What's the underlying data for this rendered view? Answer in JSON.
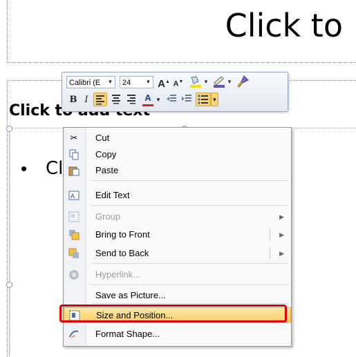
{
  "slide": {
    "title_text": "Click to",
    "subheading": "Click to add text",
    "bullet_text": "Cl"
  },
  "mini_toolbar": {
    "font_name": "Calibri (E",
    "font_size": "24",
    "buttons": {
      "grow_font": "A",
      "shrink_font": "A",
      "bold": "B",
      "italic": "I",
      "font_color": "A"
    }
  },
  "context_menu": {
    "items": [
      {
        "label": "Cut",
        "icon": "scissors-icon",
        "enabled": true
      },
      {
        "label": "Copy",
        "icon": "copy-icon",
        "enabled": true
      },
      {
        "label": "Paste",
        "icon": "paste-icon",
        "enabled": true
      },
      {
        "label": "Edit Text",
        "icon": "edit-text-icon",
        "enabled": true
      },
      {
        "label": "Group",
        "icon": "group-icon",
        "enabled": false,
        "submenu": true
      },
      {
        "label": "Bring to Front",
        "icon": "bring-to-front-icon",
        "enabled": true,
        "submenu": true
      },
      {
        "label": "Send to Back",
        "icon": "send-to-back-icon",
        "enabled": true,
        "submenu": true
      },
      {
        "label": "Hyperlink...",
        "icon": "hyperlink-icon",
        "enabled": false
      },
      {
        "label": "Save as Picture...",
        "enabled": true
      },
      {
        "label": "Size and Position...",
        "icon": "size-position-icon",
        "enabled": true,
        "highlighted": true
      },
      {
        "label": "Format Shape...",
        "icon": "format-shape-icon",
        "enabled": true
      }
    ]
  },
  "colors": {
    "highlight": "#f9cf6a",
    "callout_border": "#e00000",
    "font_color_bar": "#e02020",
    "highlight_color_bar": "#f5e400"
  }
}
